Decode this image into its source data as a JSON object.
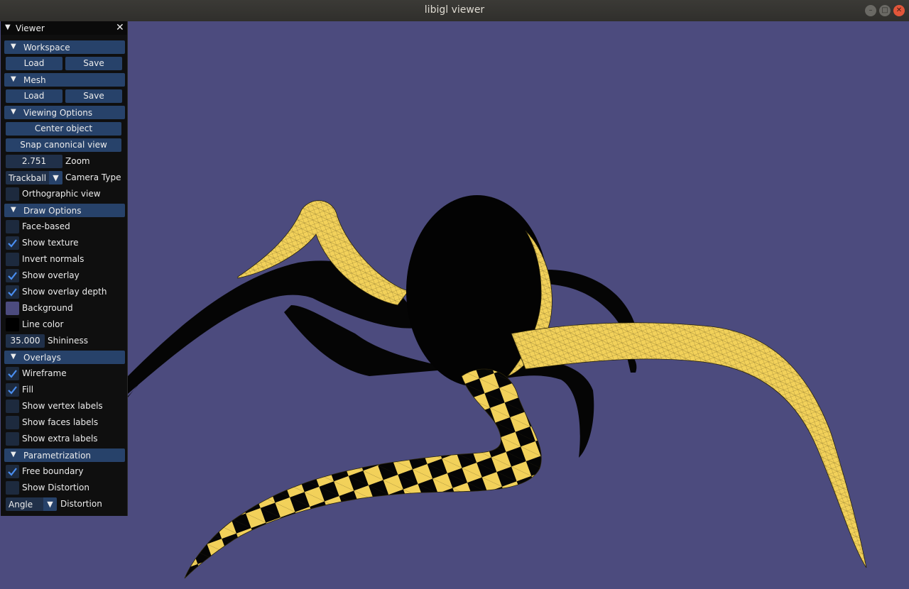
{
  "window": {
    "title": "libigl viewer"
  },
  "panel": {
    "title": "Viewer",
    "workspace": {
      "header": "Workspace",
      "load": "Load",
      "save": "Save"
    },
    "mesh": {
      "header": "Mesh",
      "load": "Load",
      "save": "Save"
    },
    "viewing": {
      "header": "Viewing Options",
      "center": "Center object",
      "snap": "Snap canonical view",
      "zoom_value": "2.751",
      "zoom_label": "Zoom",
      "camera_value": "Trackball",
      "camera_label": "Camera Type",
      "ortho_label": "Orthographic view"
    },
    "draw": {
      "header": "Draw Options",
      "face_based": "Face-based",
      "show_texture": "Show texture",
      "invert_normals": "Invert normals",
      "show_overlay": "Show overlay",
      "show_overlay_depth": "Show overlay depth",
      "background": "Background",
      "line_color": "Line color",
      "shininess_value": "35.000",
      "shininess_label": "Shininess"
    },
    "overlays": {
      "header": "Overlays",
      "wireframe": "Wireframe",
      "fill": "Fill",
      "vertex_labels": "Show vertex labels",
      "faces_labels": "Show faces labels",
      "extra_labels": "Show extra labels"
    },
    "param": {
      "header": "Parametrization",
      "free_boundary": "Free boundary",
      "show_distortion": "Show Distortion",
      "distortion_value": "Angle",
      "distortion_label": "Distortion"
    }
  },
  "colors": {
    "background": "#4c4b7e",
    "mesh": "#f2d15a",
    "line": "#000000",
    "accent": "#4a8ef0"
  },
  "checkbox_states": {
    "orthographic": false,
    "face_based": false,
    "show_texture": true,
    "invert_normals": false,
    "show_overlay": true,
    "show_overlay_depth": true,
    "wireframe": true,
    "fill": true,
    "vertex_labels": false,
    "faces_labels": false,
    "extra_labels": false,
    "free_boundary": true,
    "show_distortion": false
  }
}
